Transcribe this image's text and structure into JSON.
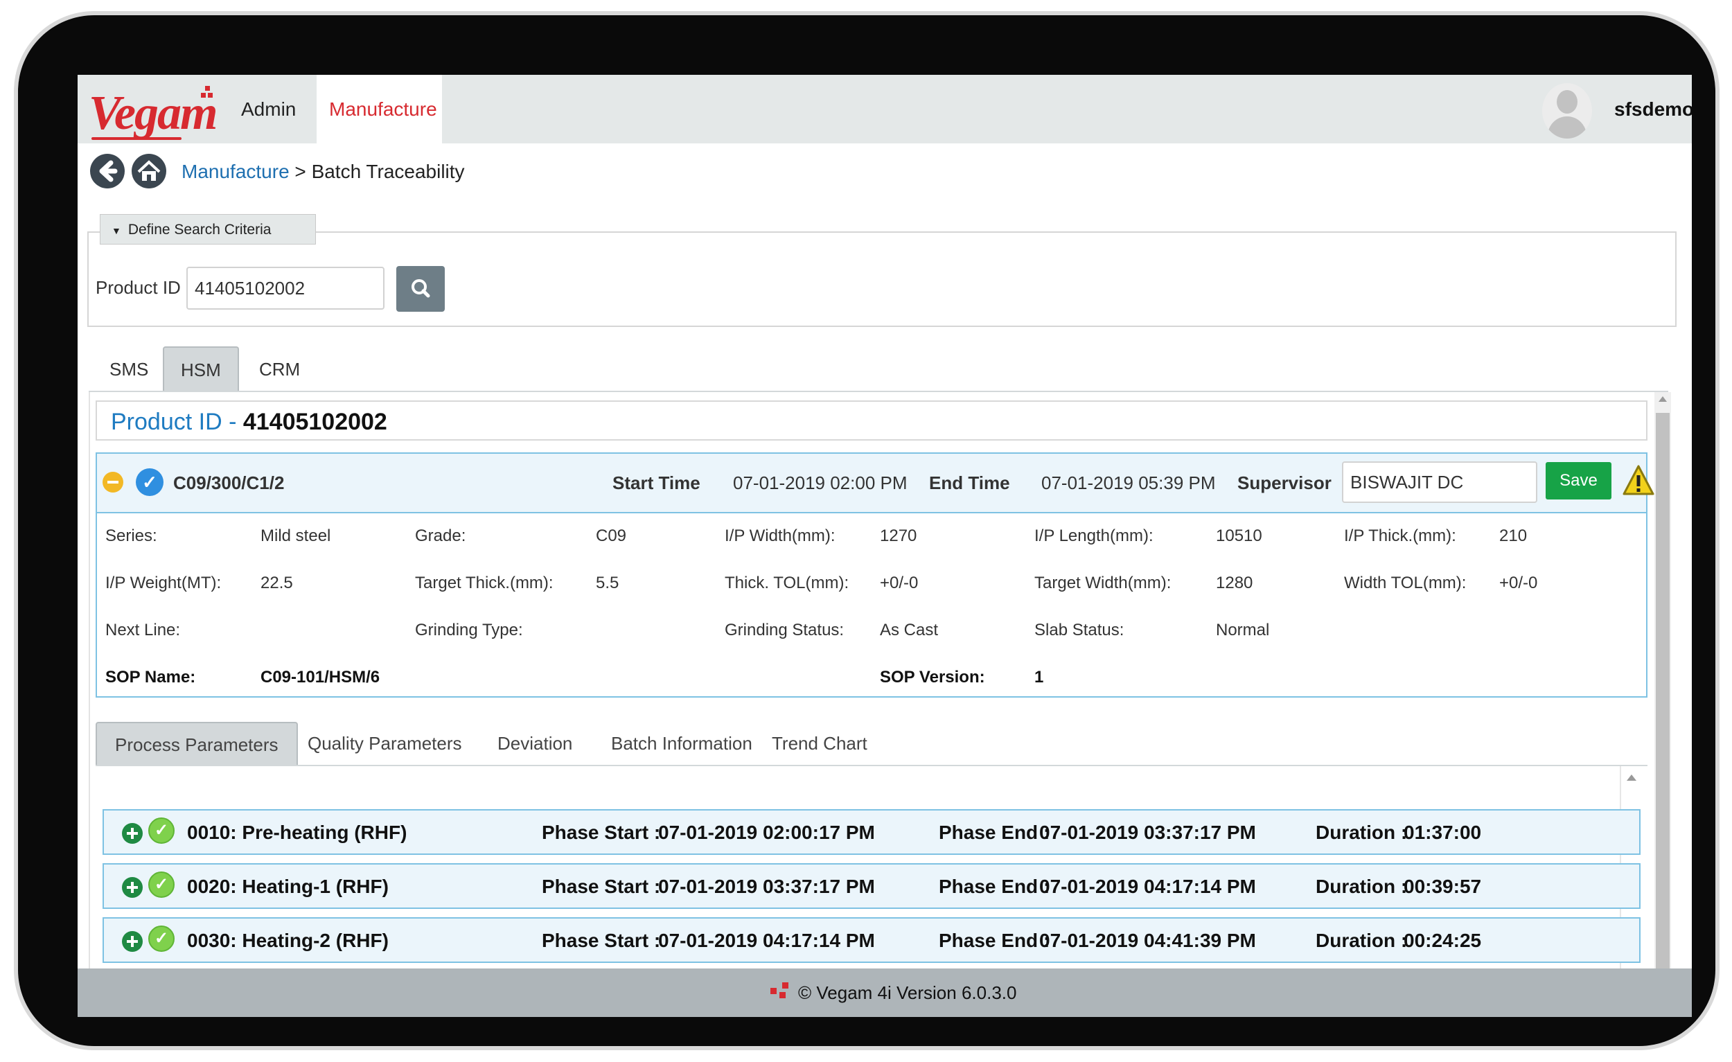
{
  "app": {
    "logo_text": "Vegam",
    "brand_color": "#d72a30"
  },
  "nav": {
    "admin": "Admin",
    "manufacture": "Manufacture"
  },
  "user": {
    "name": "sfsdemo"
  },
  "breadcrumb": {
    "link": "Manufacture",
    "separator": ">",
    "current": "Batch Traceability"
  },
  "search": {
    "legend": "Define Search Criteria",
    "product_id_label": "Product ID",
    "product_id_value": "41405102002"
  },
  "tabs": [
    "SMS",
    "HSM",
    "CRM"
  ],
  "active_tab": "HSM",
  "product": {
    "label": "Product ID -",
    "value": "41405102002"
  },
  "batch": {
    "code": "C09/300/C1/2",
    "start_time_label": "Start Time",
    "start_time": "07-01-2019 02:00 PM",
    "end_time_label": "End Time",
    "end_time": "07-01-2019 05:39 PM",
    "supervisor_label": "Supervisor",
    "supervisor": "BISWAJIT DC",
    "save_label": "Save",
    "info": [
      [
        {
          "label": "Series:",
          "value": "Mild steel"
        },
        {
          "label": "Grade:",
          "value": "C09"
        },
        {
          "label": "I/P Width(mm):",
          "value": "1270"
        },
        {
          "label": "I/P Length(mm):",
          "value": "10510"
        },
        {
          "label": "I/P Thick.(mm):",
          "value": "210"
        }
      ],
      [
        {
          "label": "I/P Weight(MT):",
          "value": "22.5"
        },
        {
          "label": "Target Thick.(mm):",
          "value": "5.5"
        },
        {
          "label": "Thick. TOL(mm):",
          "value": "+0/-0"
        },
        {
          "label": "Target Width(mm):",
          "value": "1280"
        },
        {
          "label": "Width TOL(mm):",
          "value": "+0/-0"
        }
      ],
      [
        {
          "label": "Next Line:",
          "value": ""
        },
        {
          "label": "Grinding Type:",
          "value": ""
        },
        {
          "label": "Grinding Status:",
          "value": "As Cast"
        },
        {
          "label": "Slab Status:",
          "value": "Normal"
        }
      ]
    ],
    "sop_name_label": "SOP Name:",
    "sop_name": "C09-101/HSM/6",
    "sop_version_label": "SOP Version:",
    "sop_version": "1"
  },
  "subtabs": [
    "Process Parameters",
    "Quality Parameters",
    "Deviation",
    "Batch Information",
    "Trend Chart"
  ],
  "active_subtab": "Process Parameters",
  "phases": [
    {
      "name": "0010:  Pre-heating  (RHF)",
      "start_label": "Phase Start :",
      "start": "07-01-2019 02:00:17 PM",
      "end_label": "Phase End :",
      "end": "07-01-2019 03:37:17 PM",
      "duration_label": "Duration :",
      "duration": "01:37:00"
    },
    {
      "name": "0020:  Heating-1  (RHF)",
      "start_label": "Phase Start :",
      "start": "07-01-2019 03:37:17 PM",
      "end_label": "Phase End :",
      "end": "07-01-2019 04:17:14 PM",
      "duration_label": "Duration :",
      "duration": "00:39:57"
    },
    {
      "name": "0030:  Heating-2  (RHF)",
      "start_label": "Phase Start :",
      "start": "07-01-2019 04:17:14 PM",
      "end_label": "Phase End :",
      "end": "07-01-2019 04:41:39 PM",
      "duration_label": "Duration :",
      "duration": "00:24:25"
    }
  ],
  "footer": {
    "text": "© Vegam 4i Version 6.0.3.0"
  }
}
